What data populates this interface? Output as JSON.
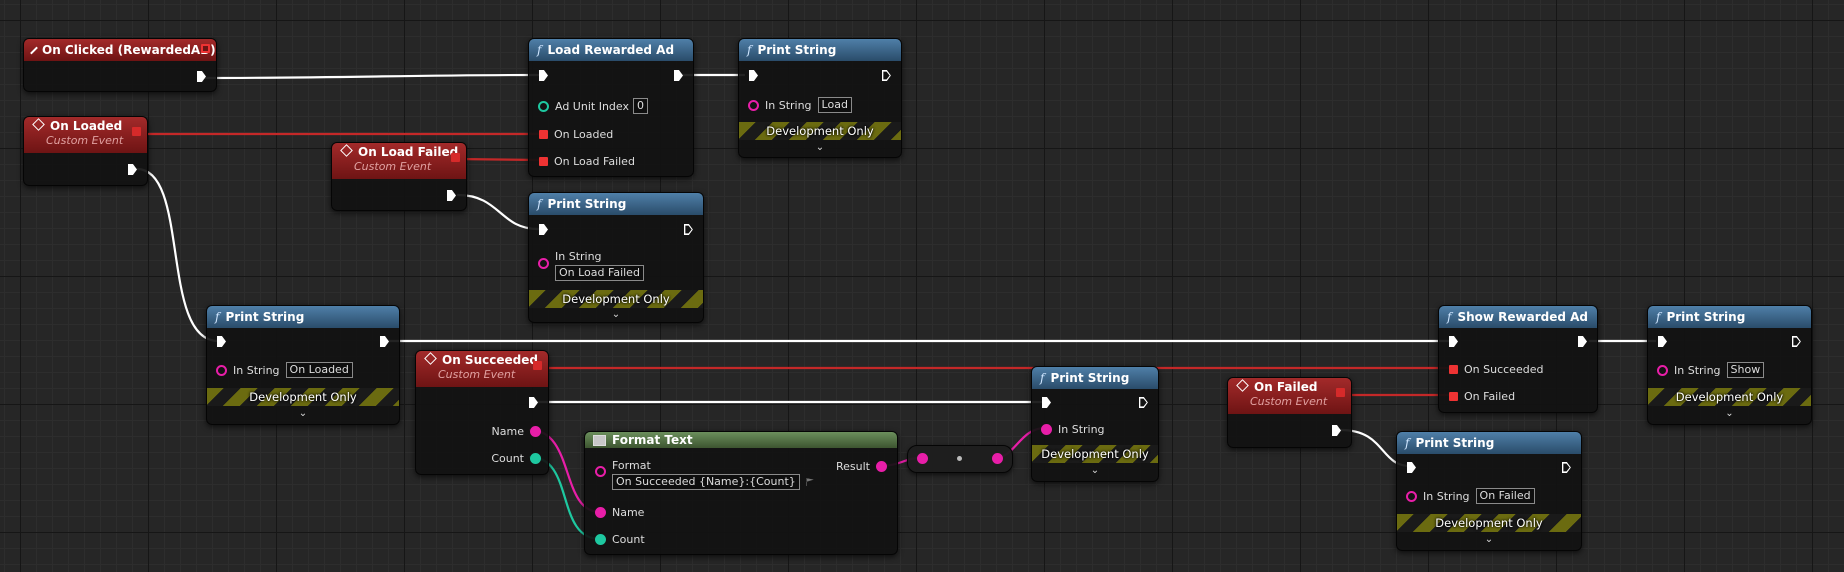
{
  "colors": {
    "exec_wire": "#ffffff",
    "event_wire": "#d42c2c",
    "string_wire": "#e81ea8",
    "int_wire": "#1ec8a0",
    "event_header": "#8b1e1e",
    "function_header": "#3f6a8e",
    "format_text_header": "#5a7a4c",
    "dev_only_stripe": "#6b6b10"
  },
  "dev_only_label": "Development Only",
  "in_string_label": "In String",
  "custom_event_label": "Custom Event",
  "nodes": {
    "on_clicked": {
      "title": "On Clicked (RewardedAD)",
      "icon": "event-diamond-icon"
    },
    "on_loaded": {
      "title": "On Loaded",
      "subtitle": "Custom Event"
    },
    "on_load_failed": {
      "title": "On Load Failed",
      "subtitle": "Custom Event"
    },
    "load_rewarded_ad": {
      "title": "Load Rewarded Ad",
      "icon": "function-icon",
      "pins": {
        "ad_unit_index": "Ad Unit Index",
        "ad_unit_index_value": "0",
        "on_loaded": "On Loaded",
        "on_load_failed": "On Load Failed"
      }
    },
    "print_load": {
      "title": "Print String",
      "in_string_value": "Load"
    },
    "print_load_failed": {
      "title": "Print String",
      "in_string_value": "On Load Failed"
    },
    "print_loaded": {
      "title": "Print String",
      "in_string_value": "On Loaded"
    },
    "on_succeeded": {
      "title": "On Succeeded",
      "subtitle": "Custom Event",
      "pins": {
        "name": "Name",
        "count": "Count"
      }
    },
    "format_text": {
      "title": "Format Text",
      "pins": {
        "format": "Format",
        "format_value": "On Succeeded {Name}:{Count}",
        "name": "Name",
        "count": "Count",
        "result": "Result"
      }
    },
    "print_succeeded": {
      "title": "Print String"
    },
    "show_rewarded_ad": {
      "title": "Show Rewarded Ad",
      "pins": {
        "on_succeeded": "On Succeeded",
        "on_failed": "On Failed"
      }
    },
    "print_show": {
      "title": "Print String",
      "in_string_value": "Show"
    },
    "on_failed": {
      "title": "On Failed",
      "subtitle": "Custom Event"
    },
    "print_failed": {
      "title": "Print String",
      "in_string_value": "On Failed"
    }
  }
}
